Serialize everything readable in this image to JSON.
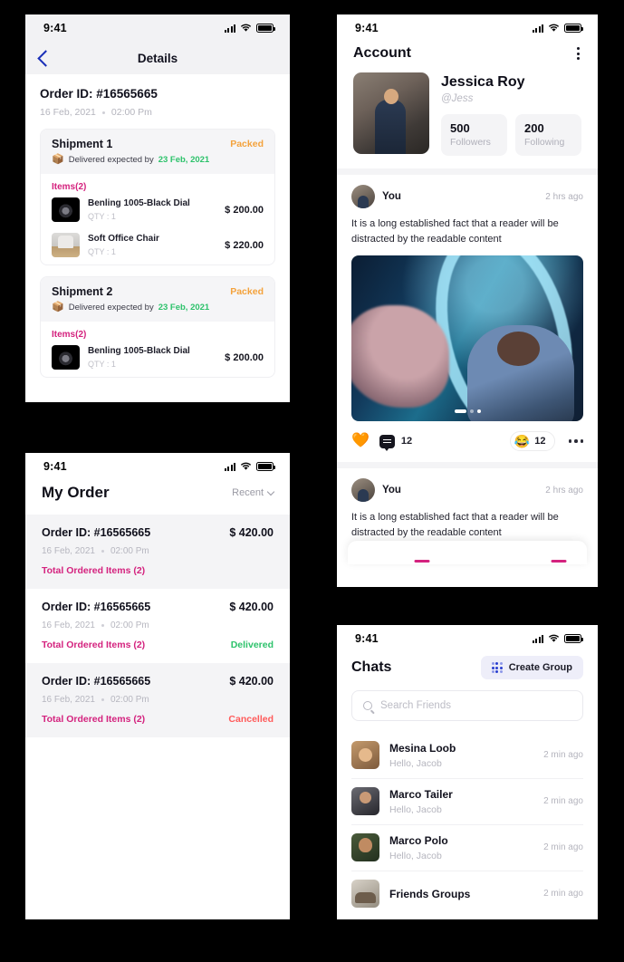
{
  "status_bar": {
    "time": "9:41"
  },
  "colors": {
    "pink": "#d4227e",
    "orange": "#f4a23c",
    "green": "#2dc26b",
    "red": "#ff5a5a",
    "blue": "#2a3fd0"
  },
  "details_screen": {
    "back_icon": "chevron-left-icon",
    "title": "Details",
    "order_id": "Order ID: #16565665",
    "date": "16 Feb, 2021",
    "time": "02:00 Pm",
    "shipments": [
      {
        "name": "Shipment 1",
        "status": "Packed",
        "delivery_label": "Delivered expected by",
        "delivery_date": "23 Feb, 2021",
        "items_label": "Items(2)",
        "items": [
          {
            "name": "Benling  1005-Black Dial",
            "qty": "QTY : 1",
            "price": "$ 200.00",
            "thumb": "watch"
          },
          {
            "name": "Soft Office Chair",
            "qty": "QTY : 1",
            "price": "$ 220.00",
            "thumb": "chair"
          }
        ]
      },
      {
        "name": "Shipment 2",
        "status": "Packed",
        "delivery_label": "Delivered expected by",
        "delivery_date": "23 Feb, 2021",
        "items_label": "Items(2)",
        "items": [
          {
            "name": "Benling  1005-Black Dial",
            "qty": "QTY : 1",
            "price": "$ 200.00",
            "thumb": "watch"
          }
        ]
      }
    ]
  },
  "orders_screen": {
    "title": "My Order",
    "sort_label": "Recent",
    "rows": [
      {
        "order_id": "Order ID: #16565665",
        "amount": "$ 420.00",
        "date": "16 Feb, 2021",
        "time": "02:00 Pm",
        "total_items": "Total Ordered Items (2)",
        "status": ""
      },
      {
        "order_id": "Order ID: #16565665",
        "amount": "$ 420.00",
        "date": "16 Feb, 2021",
        "time": "02:00 Pm",
        "total_items": "Total Ordered Items (2)",
        "status": "Delivered"
      },
      {
        "order_id": "Order ID: #16565665",
        "amount": "$ 420.00",
        "date": "16 Feb, 2021",
        "time": "02:00 Pm",
        "total_items": "Total Ordered Items (2)",
        "status": "Cancelled"
      }
    ]
  },
  "account_screen": {
    "title": "Account",
    "menu_icon": "kebab-menu-icon",
    "profile": {
      "name": "Jessica Roy",
      "handle": "@Jess",
      "followers_count": "500",
      "followers_label": "Followers",
      "following_count": "200",
      "following_label": "Following"
    },
    "posts": [
      {
        "author": "You",
        "time": "2 hrs ago",
        "text": "It is a long established fact that a reader will be distracted by the readable content",
        "has_media": true,
        "heart_icon": "heart-icon",
        "comment_icon": "comment-bubble-icon",
        "comment_count": "12",
        "reaction_emoji": "laughing-emoji-icon",
        "reaction_count": "12",
        "more_icon": "more-horizontal-icon"
      },
      {
        "author": "You",
        "time": "2 hrs ago",
        "text": "It is a long established fact that a reader will be distracted by the readable content",
        "has_media": false
      }
    ]
  },
  "chats_screen": {
    "title": "Chats",
    "create_group_label": "Create Group",
    "create_group_icon": "group-dots-icon",
    "search": {
      "placeholder": "Search Friends",
      "value": "",
      "icon": "search-icon"
    },
    "rows": [
      {
        "name": "Mesina Loob",
        "message": "Hello, Jacob",
        "time": "2 min ago",
        "avatar": "a1"
      },
      {
        "name": "Marco Tailer",
        "message": "Hello, Jacob",
        "time": "2 min ago",
        "avatar": "a2"
      },
      {
        "name": "Marco Polo",
        "message": "Hello, Jacob",
        "time": "2 min ago",
        "avatar": "a3"
      },
      {
        "name": "Friends Groups",
        "message": "",
        "time": "2 min ago",
        "avatar": "a4"
      }
    ]
  }
}
